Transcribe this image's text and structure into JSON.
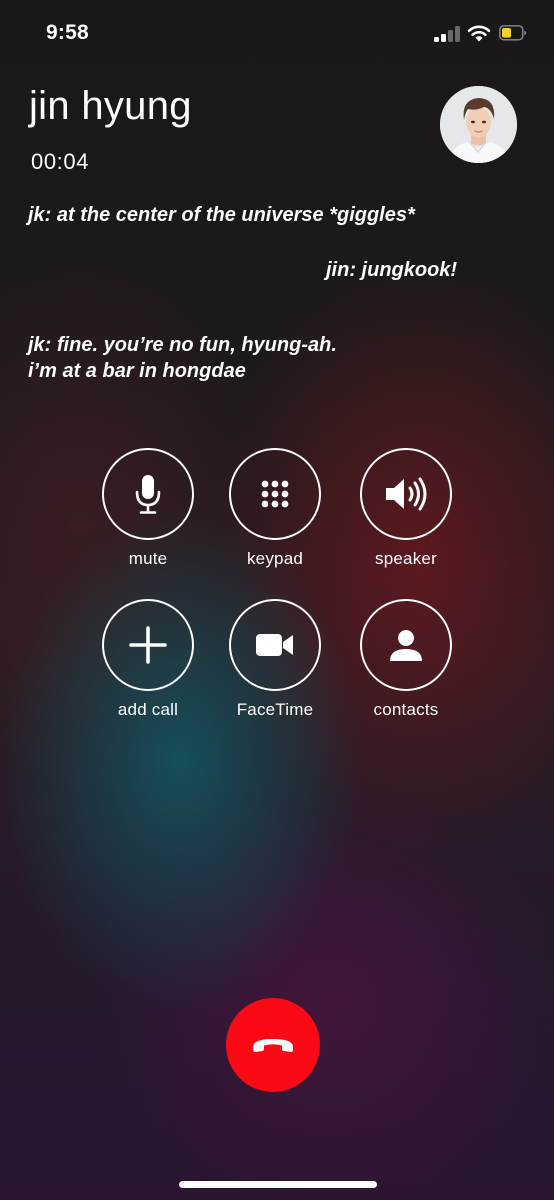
{
  "status_bar": {
    "time": "9:58",
    "signal_icon": "cellular-signal-icon",
    "wifi_icon": "wifi-icon",
    "battery_icon": "battery-low-icon",
    "battery_color": "#f7d31c"
  },
  "call": {
    "name": "jin hyung",
    "duration": "00:04",
    "avatar_icon": "contact-photo"
  },
  "dialogue": [
    "jk: at the center of the universe *giggles*",
    "jin: jungkook!",
    "jk: fine. you’re no fun, hyung-ah.",
    "i’m at a bar in hongdae"
  ],
  "controls": [
    {
      "label": "mute",
      "icon": "microphone-icon"
    },
    {
      "label": "keypad",
      "icon": "keypad-icon"
    },
    {
      "label": "speaker",
      "icon": "speaker-icon"
    },
    {
      "label": "add call",
      "icon": "plus-icon"
    },
    {
      "label": "FaceTime",
      "icon": "video-camera-icon"
    },
    {
      "label": "contacts",
      "icon": "person-icon"
    }
  ],
  "end_call": {
    "icon": "hang-up-icon",
    "color": "#fb0a16"
  }
}
